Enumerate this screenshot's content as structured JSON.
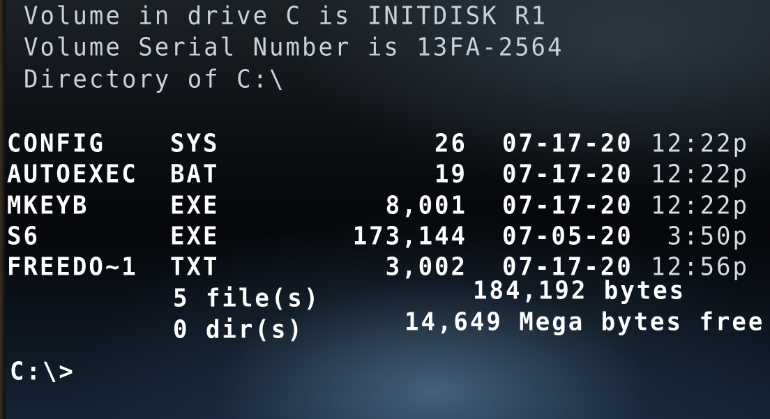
{
  "header": {
    "volume_label_line": "Volume in drive C is INITDISK R1",
    "serial_line": "Volume Serial Number is 13FA-2564",
    "directory_line": "Directory of C:\\"
  },
  "files": [
    {
      "name": "CONFIG",
      "ext": "SYS",
      "size": "26",
      "date": "07-17-20",
      "time": "12:22p"
    },
    {
      "name": "AUTOEXEC",
      "ext": "BAT",
      "size": "19",
      "date": "07-17-20",
      "time": "12:22p"
    },
    {
      "name": "MKEYB",
      "ext": "EXE",
      "size": "8,001",
      "date": "07-17-20",
      "time": "12:22p"
    },
    {
      "name": "S6",
      "ext": "EXE",
      "size": "173,144",
      "date": "07-05-20",
      "time": "3:50p"
    },
    {
      "name": "FREEDO~1",
      "ext": "TXT",
      "size": "3,002",
      "date": "07-17-20",
      "time": "12:56p"
    }
  ],
  "summary": {
    "files_count": "5 file(s)",
    "files_bytes": "184,192 bytes",
    "dirs_count": "0 dir(s)",
    "free_space": "14,649 Mega bytes free"
  },
  "prompt": "C:\\>"
}
